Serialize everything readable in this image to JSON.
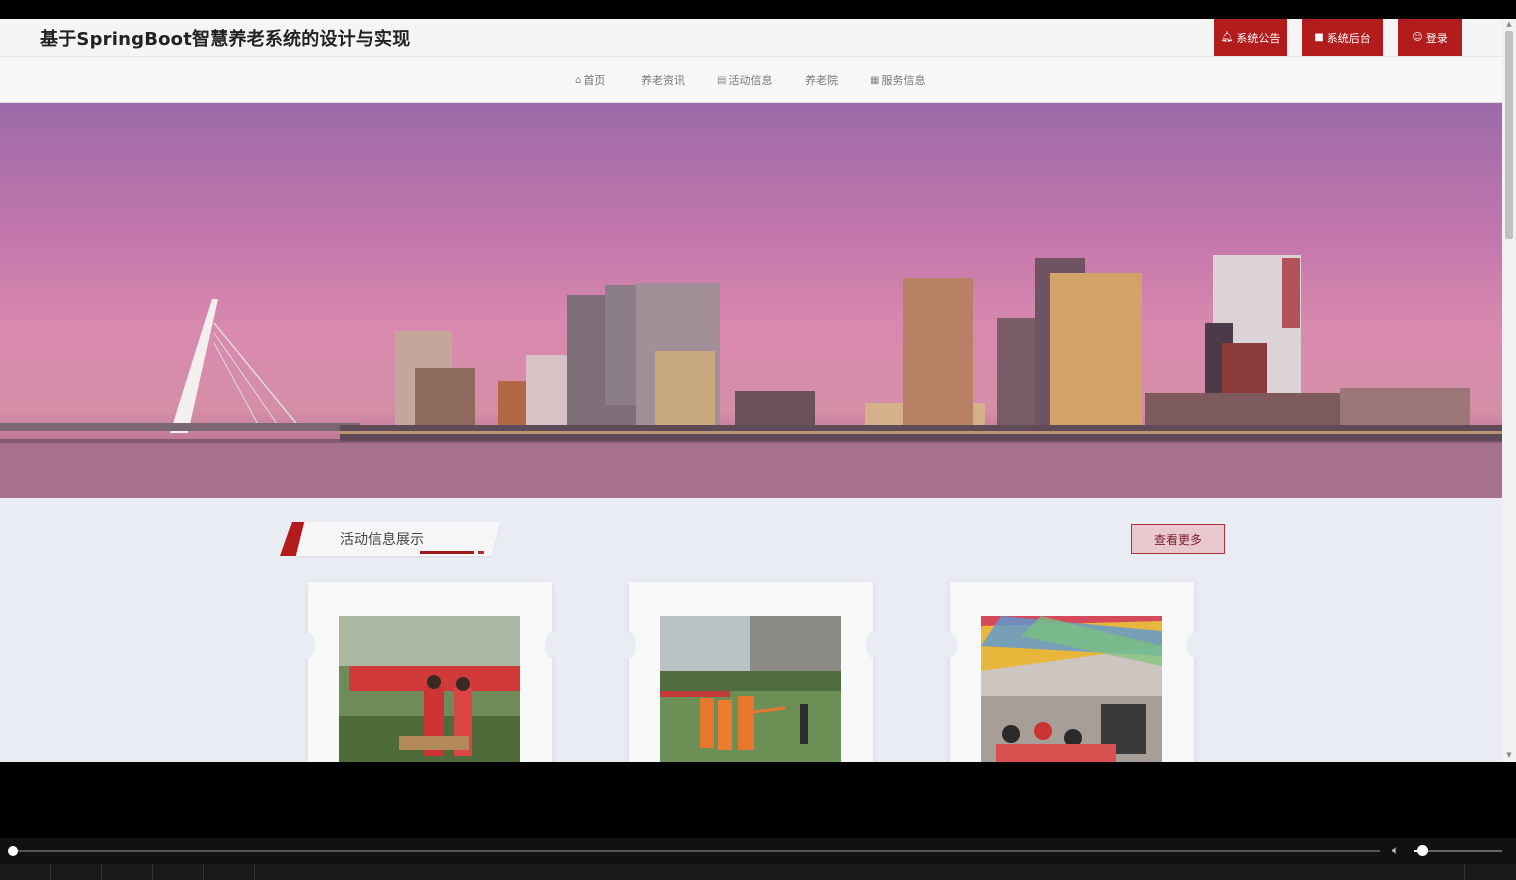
{
  "header": {
    "site_title": "基于SpringBoot智慧养老系统的设计与实现",
    "buttons": [
      {
        "label": "系统公告",
        "icon": "bell-icon"
      },
      {
        "label": "系统后台",
        "icon": "book-icon"
      },
      {
        "label": "登录",
        "icon": "user-icon"
      }
    ]
  },
  "nav": {
    "items": [
      {
        "label": "首页",
        "icon": "home-icon"
      },
      {
        "label": "养老资讯",
        "icon": ""
      },
      {
        "label": "活动信息",
        "icon": "list-icon"
      },
      {
        "label": "养老院",
        "icon": ""
      },
      {
        "label": "服务信息",
        "icon": "building-icon"
      }
    ]
  },
  "banner": {
    "description_icon": "city-skyline-image"
  },
  "section": {
    "title": "活动信息展示",
    "more_label": "查看更多"
  },
  "cards": [
    {
      "image": "community-event-photo"
    },
    {
      "image": "outdoor-exercise-photo"
    },
    {
      "image": "indoor-activity-photo"
    }
  ],
  "colors": {
    "accent": "#b31c1c",
    "nav_text": "#777777",
    "page_bg": "#e9ecf3"
  }
}
